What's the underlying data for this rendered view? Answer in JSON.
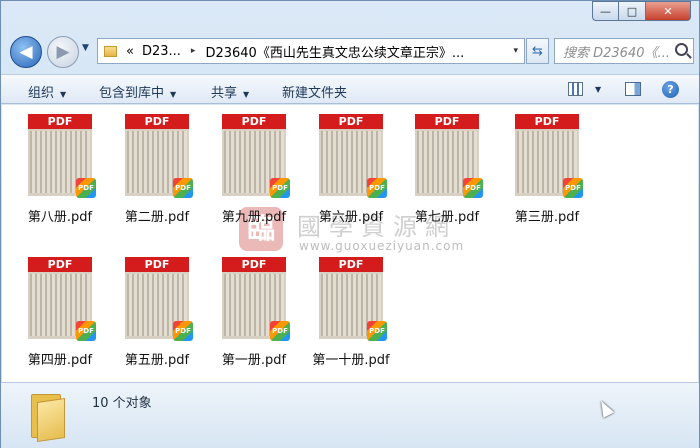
{
  "window": {
    "controls": {
      "minimize": "—",
      "maximize": "□",
      "close": "✕"
    }
  },
  "nav": {
    "back_icon": "back-arrow-icon",
    "forward_icon": "forward-arrow-icon",
    "recent_dropdown": "▼"
  },
  "address": {
    "prefix": "«",
    "crumb1": "D23...",
    "separator": "▸",
    "crumb2": "D23640《西山先生真文忠公续文章正宗》...",
    "dropdown": "▾",
    "refresh_icon": "⇆"
  },
  "search": {
    "placeholder": "搜索 D23640《..."
  },
  "toolbar": {
    "organize": "组织",
    "include_in_library": "包含到库中",
    "share": "共享",
    "new_folder": "新建文件夹",
    "arrow": "▼",
    "help": "?"
  },
  "files": [
    {
      "name": "第八册.pdf"
    },
    {
      "name": "第二册.pdf"
    },
    {
      "name": "第九册.pdf"
    },
    {
      "name": "第六册.pdf"
    },
    {
      "name": "第七册.pdf"
    },
    {
      "name": "第三册.pdf"
    },
    {
      "name": "第四册.pdf"
    },
    {
      "name": "第五册.pdf"
    },
    {
      "name": "第一册.pdf"
    },
    {
      "name": "第一十册.pdf"
    }
  ],
  "thumb_label": "PDF",
  "badge_text": "PDF",
  "watermark": {
    "seal": "臨",
    "title": "國學資源網",
    "url": "www.guoxueziyuan.com"
  },
  "status": {
    "count": "10 个对象"
  }
}
